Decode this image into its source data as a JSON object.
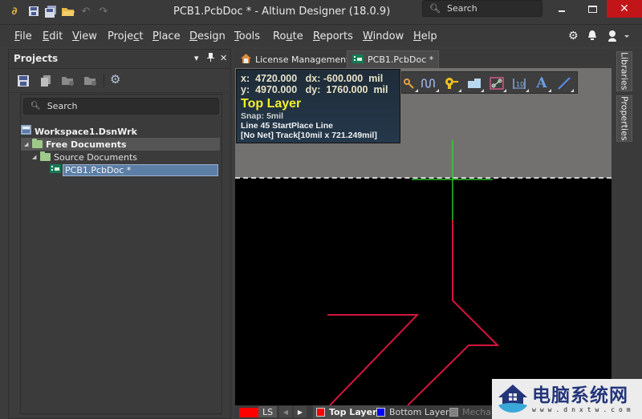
{
  "window": {
    "title": "PCB1.PcbDoc * - Altium Designer (18.0.9)",
    "search_placeholder": "Search",
    "minimize_icon": "minimize-icon",
    "maximize_icon": "maximize-icon",
    "close_glyph": "✕"
  },
  "quick_access": [
    "app-logo-icon",
    "save-icon",
    "save-all-icon",
    "open-folder-icon",
    "undo-icon",
    "redo-icon"
  ],
  "menu": {
    "items": [
      {
        "label": "File",
        "accel": "F"
      },
      {
        "label": "Edit",
        "accel": "E"
      },
      {
        "label": "View",
        "accel": "V"
      },
      {
        "label": "Project",
        "accel": "c"
      },
      {
        "label": "Place",
        "accel": "P"
      },
      {
        "label": "Design",
        "accel": "D"
      },
      {
        "label": "Tools",
        "accel": "T"
      },
      {
        "label": "Route",
        "accel": "u"
      },
      {
        "label": "Reports",
        "accel": "R"
      },
      {
        "label": "Window",
        "accel": "W"
      },
      {
        "label": "Help",
        "accel": "H"
      }
    ],
    "right_icons": [
      "gear-icon",
      "bell-icon",
      "user-icon"
    ]
  },
  "projects_panel": {
    "title": "Projects",
    "controls": [
      "▾",
      "⊥",
      "✕"
    ],
    "toolbar_icons": [
      "save-project-icon",
      "copy-project-icon",
      "add-folder-icon",
      "remove-folder-icon",
      "settings-icon"
    ],
    "search_placeholder": "Search",
    "tree": [
      {
        "label": "Workspace1.DsnWrk",
        "level": 0,
        "type": "workspace",
        "bold": true
      },
      {
        "label": "Free Documents",
        "level": 1,
        "type": "folder",
        "bold": true,
        "expanded": true
      },
      {
        "label": "Source Documents",
        "level": 2,
        "type": "folder",
        "bold": false,
        "expanded": true
      },
      {
        "label": "PCB1.PcbDoc *",
        "level": 3,
        "type": "pcb",
        "bold": false,
        "selected": true
      }
    ]
  },
  "doc_tabs": [
    {
      "label": "License Management",
      "icon": "home-icon",
      "active": false
    },
    {
      "label": "PCB1.PcbDoc *",
      "icon": "pcb-icon",
      "active": true
    }
  ],
  "hud": {
    "x_label": "x:",
    "x_value": "4720.000",
    "dx_label": "dx:",
    "dx_value": "-600.000",
    "y_label": "y:",
    "y_value": "4970.000",
    "dy_label": "dy:",
    "dy_value": "1760.000",
    "unit": "mil",
    "layer": "Top Layer",
    "snap": "Snap: 5mil",
    "status": "Line 45 StartPlace Line",
    "track": "[No Net] Track[10mil x 721.249mil]"
  },
  "place_toolbar": [
    "interactive-route-icon",
    "diff-pair-icon",
    "pad-icon",
    "polygon-icon",
    "component-icon",
    "dimension-icon",
    "string-icon",
    "line-icon"
  ],
  "right_dock": {
    "tabs": [
      "Libraries",
      "Properties"
    ]
  },
  "layer_bar": {
    "current_color": "#ff0000",
    "ls_label": "LS",
    "layers": [
      {
        "label": "Top Layer",
        "color": "#ff0000",
        "active": true
      },
      {
        "label": "Bottom Layer",
        "color": "#0000ff",
        "active": false
      },
      {
        "label": "Mechanical",
        "color": "#808080",
        "active": false
      }
    ]
  },
  "colors": {
    "track": "#d4143c",
    "cursor": "#33dd33",
    "hud_layer": "#f5ef2a",
    "close_button": "#c2151a"
  },
  "watermark": {
    "text": "电脑系统网",
    "url": "www.dnxtw.com"
  }
}
